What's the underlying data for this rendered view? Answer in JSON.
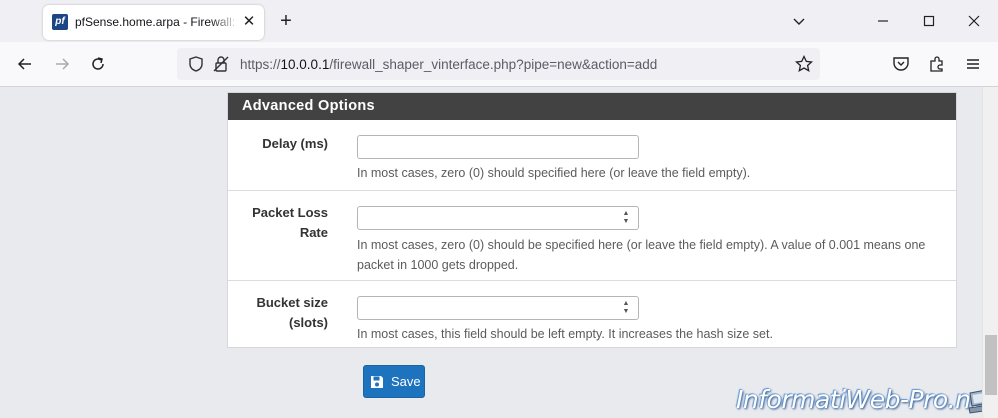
{
  "browser": {
    "tab": {
      "favicon_text": "pf",
      "title": "pfSense.home.arpa - Firewall: Tr"
    },
    "url_prefix": "https://",
    "url_host": "10.0.0.1",
    "url_path": "/firewall_shaper_vinterface.php?pipe=new&action=add"
  },
  "panel": {
    "heading": "Advanced Options",
    "rows": [
      {
        "label_lines": [
          "Delay (ms)"
        ],
        "value": "",
        "help": "In most cases, zero (0) should specified here (or leave the field empty)."
      },
      {
        "label_lines": [
          "Packet Loss",
          "Rate"
        ],
        "value": "",
        "help": "In most cases, zero (0) should be specified here (or leave the field empty). A value of 0.001 means one packet in 1000 gets dropped."
      },
      {
        "label_lines": [
          "Bucket size",
          "(slots)"
        ],
        "value": "",
        "help": "In most cases, this field should be left empty. It increases the hash size set."
      }
    ]
  },
  "actions": {
    "save_label": "Save"
  },
  "watermark": {
    "text": "InformatiWeb-Pro.net"
  },
  "colors": {
    "panel_heading_bg": "#424242",
    "save_button_bg": "#1e73be",
    "page_bg": "#e9eaee"
  }
}
